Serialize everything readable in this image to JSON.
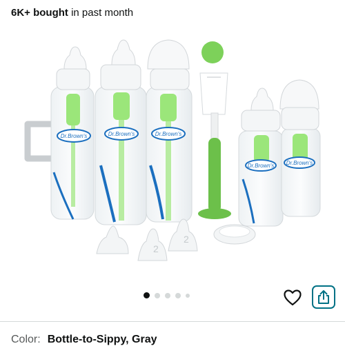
{
  "bought": {
    "count": "6K+ bought",
    "suffix": " in past month"
  },
  "product_image": {
    "brand_text": "Dr.Brown's",
    "nipple_number": "2"
  },
  "gallery": {
    "total_dots": 5,
    "active_index": 0
  },
  "actions": {
    "wishlist_icon": "heart-icon",
    "share_icon": "share-icon"
  },
  "colors": {
    "accent": "#007185",
    "bottle_green": "#8fe070",
    "brush_green": "#6cc04a",
    "brand_blue": "#1b6fbf"
  },
  "variant": {
    "label": "Color:",
    "value": "Bottle-to-Sippy, Gray"
  }
}
